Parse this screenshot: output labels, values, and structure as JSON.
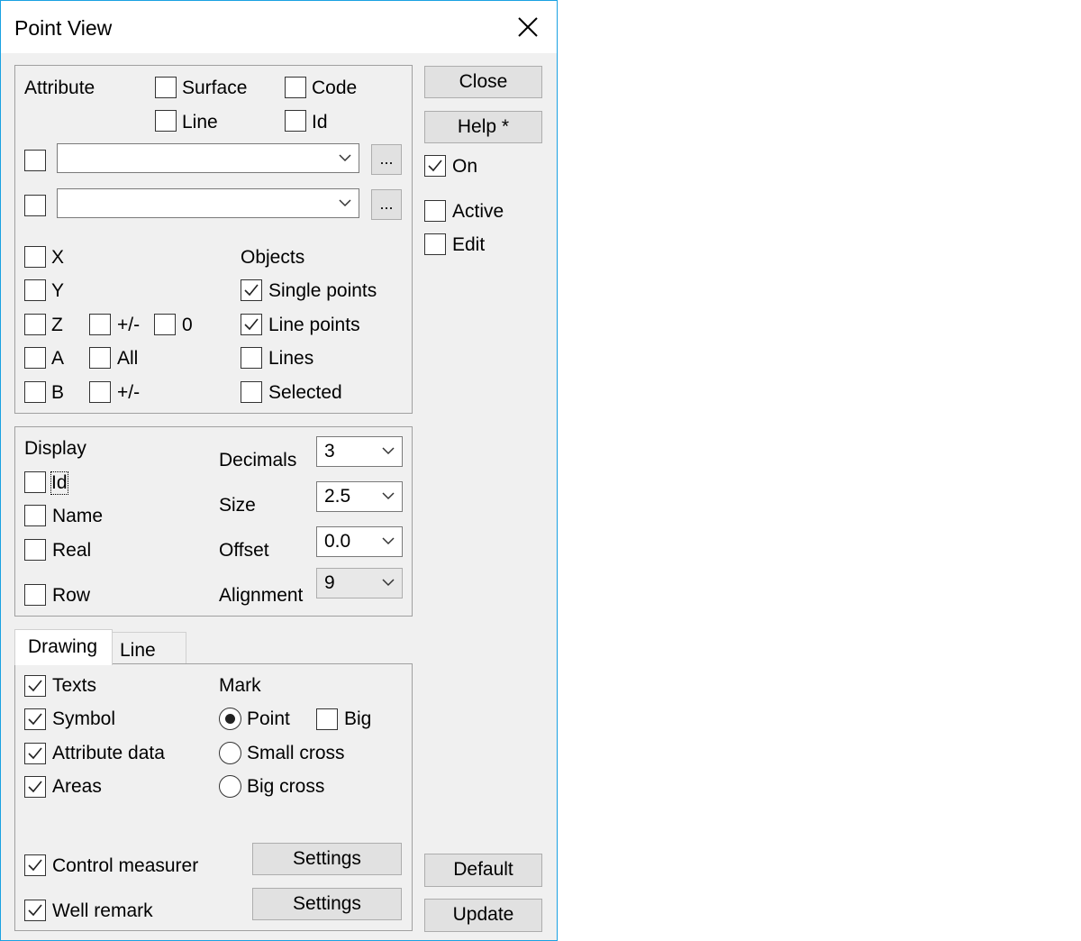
{
  "window": {
    "title": "Point View"
  },
  "buttons": {
    "close": "Close",
    "help": "Help *",
    "default": "Default",
    "update": "Update",
    "settings_control": "Settings",
    "settings_well": "Settings"
  },
  "side": {
    "on": {
      "label": "On",
      "checked": true
    },
    "active": {
      "label": "Active",
      "checked": false
    },
    "edit": {
      "label": "Edit",
      "checked": false
    }
  },
  "attribute": {
    "label": "Attribute",
    "surface": "Surface",
    "code": "Code",
    "line": "Line",
    "id": "Id",
    "combo1_value": "",
    "combo2_value": "",
    "ellipsis": "..."
  },
  "coords": {
    "x": "X",
    "y": "Y",
    "z": "Z",
    "a": "A",
    "b": "B",
    "z_plusminus": "+/-",
    "z_zero": "0",
    "a_all": "All",
    "b_plusminus": "+/-"
  },
  "objects": {
    "title": "Objects",
    "items": [
      {
        "label": "Single points",
        "checked": true
      },
      {
        "label": "Line points",
        "checked": true
      },
      {
        "label": "Lines",
        "checked": false
      },
      {
        "label": "Selected",
        "checked": false
      }
    ]
  },
  "display": {
    "title": "Display",
    "id": "Id",
    "name": "Name",
    "real": "Real",
    "row": "Row",
    "decimals_label": "Decimals",
    "decimals_value": "3",
    "size_label": "Size",
    "size_value": "2.5",
    "offset_label": "Offset",
    "offset_value": "0.0",
    "alignment_label": "Alignment",
    "alignment_value": "9"
  },
  "tabs": {
    "drawing": "Drawing",
    "line": "Line"
  },
  "drawing": {
    "texts": "Texts",
    "symbol": "Symbol",
    "attribute_data": "Attribute data",
    "areas": "Areas",
    "mark_title": "Mark",
    "point": "Point",
    "big": "Big",
    "small_cross": "Small cross",
    "big_cross": "Big cross",
    "control_measurer": "Control measurer",
    "well_remark": "Well remark"
  }
}
